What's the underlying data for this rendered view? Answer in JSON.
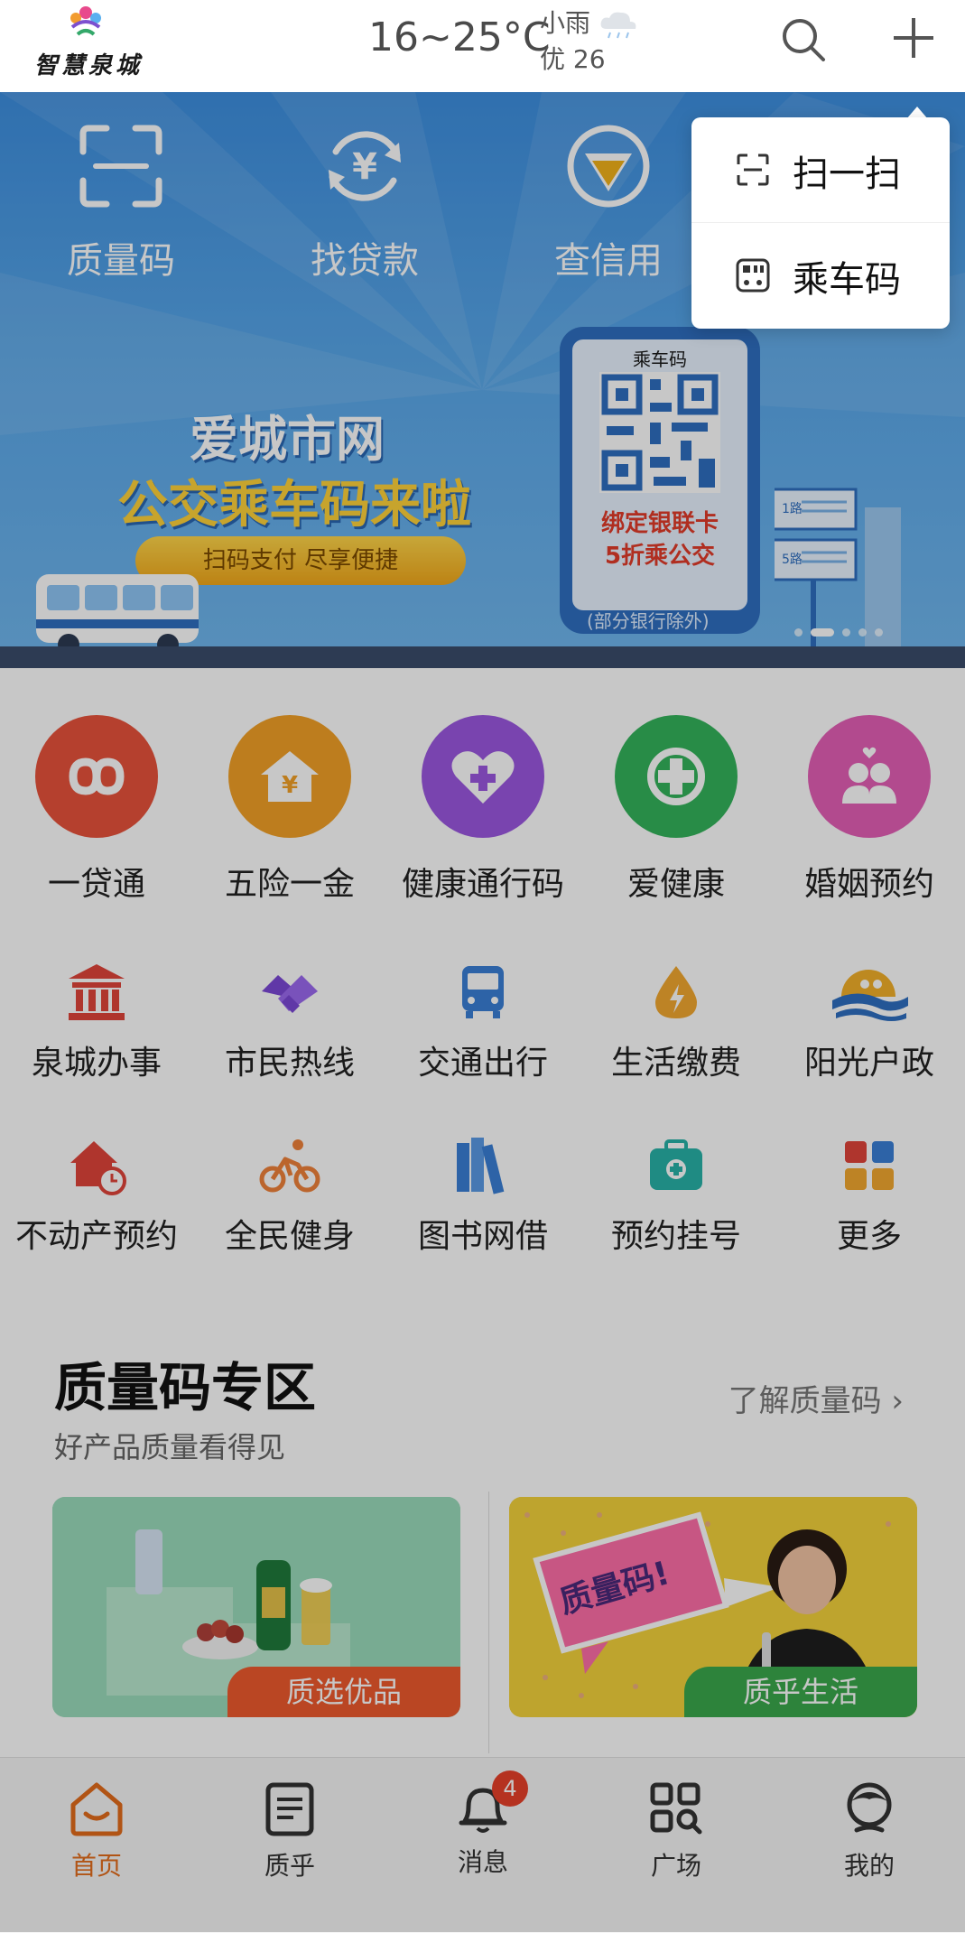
{
  "header": {
    "logo_text": "智慧泉城",
    "temperature": "16~25°C",
    "weather": "小雨",
    "air_quality": "优 26"
  },
  "banner": {
    "quick_actions": [
      {
        "label": "质量码",
        "icon": "scan-frame-icon"
      },
      {
        "label": "找贷款",
        "icon": "yuan-cycle-icon"
      },
      {
        "label": "查信用",
        "icon": "credit-icon"
      }
    ],
    "title_line1": "爱城市网",
    "title_line2": "公交乘车码来啦",
    "pill_text": "扫码支付  尽享便捷",
    "phone_title": "乘车码",
    "phone_promo_line1": "绑定银联卡",
    "phone_promo_line2": "5折乘公交",
    "footnote": "(部分银行除外)",
    "sign1": "1路",
    "sign2": "5路"
  },
  "popup_menu": {
    "items": [
      {
        "label": "扫一扫",
        "icon": "scan-icon"
      },
      {
        "label": "乘车码",
        "icon": "bus-code-icon"
      }
    ]
  },
  "services_primary": [
    {
      "label": "一贷通",
      "color": "#e8533b",
      "icon": "loan-link-icon"
    },
    {
      "label": "五险一金",
      "color": "#f2a127",
      "icon": "house-yuan-icon"
    },
    {
      "label": "健康通行码",
      "color": "#9b58e0",
      "icon": "heart-plus-icon"
    },
    {
      "label": "爱健康",
      "color": "#34b45c",
      "icon": "health-cross-icon"
    },
    {
      "label": "婚姻预约",
      "color": "#e45fb7",
      "icon": "couple-icon"
    }
  ],
  "services_row2": [
    {
      "label": "泉城办事",
      "icon": "government-building-icon"
    },
    {
      "label": "市民热线",
      "icon": "handshake-icon"
    },
    {
      "label": "交通出行",
      "icon": "bus-icon"
    },
    {
      "label": "生活缴费",
      "icon": "water-drop-icon"
    },
    {
      "label": "阳光户政",
      "icon": "sunrise-icon"
    }
  ],
  "services_row3": [
    {
      "label": "不动产预约",
      "icon": "house-clock-icon"
    },
    {
      "label": "全民健身",
      "icon": "cyclist-icon"
    },
    {
      "label": "图书网借",
      "icon": "books-icon"
    },
    {
      "label": "预约挂号",
      "icon": "medical-kit-icon"
    },
    {
      "label": "更多",
      "icon": "more-grid-icon"
    }
  ],
  "quality_zone": {
    "title": "质量码专区",
    "subtitle": "好产品质量看得见",
    "link": "了解质量码",
    "promos": [
      {
        "label": "质选优品",
        "tag_color": "#ef5a2e"
      },
      {
        "label": "质乎生活",
        "tag_color": "#3aa84c",
        "poster_text": "质量码!"
      }
    ]
  },
  "bottom_nav": [
    {
      "label": "首页",
      "icon": "home-icon",
      "active": true
    },
    {
      "label": "质乎",
      "icon": "document-icon"
    },
    {
      "label": "消息",
      "icon": "bell-icon",
      "badge": "4"
    },
    {
      "label": "广场",
      "icon": "grid-search-icon"
    },
    {
      "label": "我的",
      "icon": "profile-icon"
    }
  ],
  "colors": {
    "accent": "#e36c1c",
    "banner_blue": "#4a9be6"
  }
}
